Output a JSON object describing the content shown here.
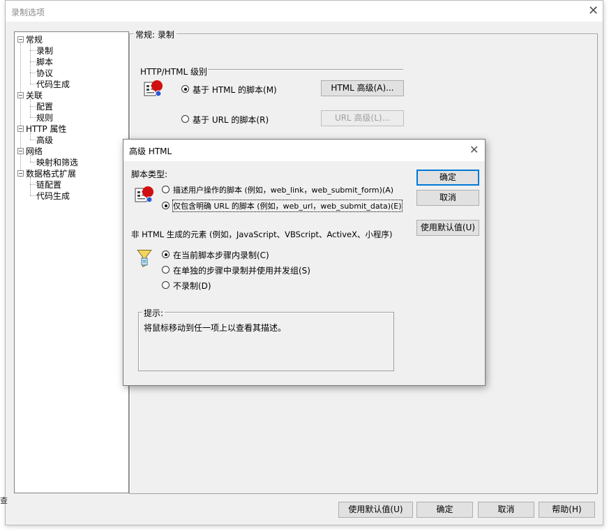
{
  "main": {
    "title": "录制选项",
    "tree": [
      {
        "label": "常规",
        "level": 0,
        "expandable": true
      },
      {
        "label": "录制",
        "level": 1
      },
      {
        "label": "脚本",
        "level": 1
      },
      {
        "label": "协议",
        "level": 1
      },
      {
        "label": "代码生成",
        "level": 1
      },
      {
        "label": "关联",
        "level": 0,
        "expandable": true
      },
      {
        "label": "配置",
        "level": 1
      },
      {
        "label": "规则",
        "level": 1
      },
      {
        "label": "HTTP 属性",
        "level": 0,
        "expandable": true
      },
      {
        "label": "高级",
        "level": 1
      },
      {
        "label": "网络",
        "level": 0,
        "expandable": true
      },
      {
        "label": "映射和筛选",
        "level": 1
      },
      {
        "label": "数据格式扩展",
        "level": 0,
        "expandable": true
      },
      {
        "label": "链配置",
        "level": 1
      },
      {
        "label": "代码生成",
        "level": 1
      }
    ],
    "panel_title": "常规: 录制",
    "group_label": "HTTP/HTML 级别",
    "radio_html": "基于 HTML 的脚本(M)",
    "radio_url": "基于 URL 的脚本(R)",
    "btn_html_advanced": "HTML 高级(A)...",
    "btn_url_advanced": "URL 高级(L)...",
    "footer": {
      "use_defaults": "使用默认值(U)",
      "ok": "确定",
      "cancel": "取消",
      "help": "帮助(H)"
    }
  },
  "dialog": {
    "title": "高级 HTML",
    "script_type_label": "脚本类型:",
    "script_option_1": "描述用户操作的脚本 (例如，web_link，web_submit_form)(A)",
    "script_option_2": "仅包含明确 URL 的脚本 (例如，web_url，web_submit_data)(E)",
    "non_html_label": "非 HTML 生成的元素 (例如，JavaScript、VBScript、ActiveX、小程序)",
    "record_option_1": "在当前脚本步骤内录制(C)",
    "record_option_2": "在单独的步骤中录制并使用并发组(S)",
    "record_option_3": "不录制(D)",
    "hint_title": "提示:",
    "hint_text": "将鼠标移动到任一项上以查看其描述。",
    "btn_ok": "确定",
    "btn_cancel": "取消",
    "btn_defaults": "使用默认值(U)"
  },
  "left_partial_text": "查"
}
